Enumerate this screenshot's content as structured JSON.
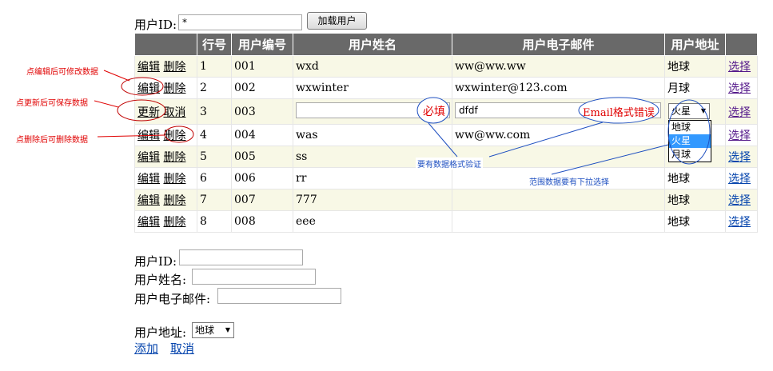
{
  "top": {
    "userid_label": "用户ID:",
    "userid_value": "*",
    "load_button": "加载用户"
  },
  "table": {
    "headers": [
      "",
      "行号",
      "用户编号",
      "用户姓名",
      "用户电子邮件",
      "用户地址",
      ""
    ],
    "rows": [
      {
        "a1": "编辑",
        "a2": "删除",
        "num": "1",
        "id": "001",
        "name": "wxd",
        "email": "ww@ww.ww",
        "addr": "地球",
        "select": "选择"
      },
      {
        "a1": "编辑",
        "a2": "删除",
        "num": "2",
        "id": "002",
        "name": "wxwinter",
        "email": "wxwinter@123.com",
        "addr": "月球",
        "select": "选择"
      },
      {
        "a1": "更新",
        "a2": "取消",
        "num": "3",
        "id": "003",
        "name": "",
        "email": "dfdf",
        "addr": "火星",
        "select": "选择"
      },
      {
        "a1": "编辑",
        "a2": "删除",
        "num": "4",
        "id": "004",
        "name": "was",
        "email": "ww@ww.com",
        "addr": "",
        "select": "选择"
      },
      {
        "a1": "编辑",
        "a2": "删除",
        "num": "5",
        "id": "005",
        "name": "ss",
        "email": "",
        "addr": "",
        "select": "选择"
      },
      {
        "a1": "编辑",
        "a2": "删除",
        "num": "6",
        "id": "006",
        "name": "rr",
        "email": "",
        "addr": "地球",
        "select": "选择"
      },
      {
        "a1": "编辑",
        "a2": "删除",
        "num": "7",
        "id": "007",
        "name": "777",
        "email": "",
        "addr": "地球",
        "select": "选择"
      },
      {
        "a1": "编辑",
        "a2": "删除",
        "num": "8",
        "id": "008",
        "name": "eee",
        "email": "",
        "addr": "地球",
        "select": "选择"
      }
    ],
    "dropdown_options": [
      "地球",
      "火星",
      "月球"
    ],
    "dropdown_selected": "火星"
  },
  "annotations": {
    "edit_note": "点编辑后可修改数据",
    "update_note": "点更新后可保存数据",
    "delete_note": "点删除后可删除数据",
    "required": "必填",
    "email_error": "Email格式错误",
    "format_validate": "要有数据格式验证",
    "range_dropdown": "范围数据要有下拉选择"
  },
  "form": {
    "userid_label": "用户ID:",
    "name_label": "用户姓名:",
    "email_label": "用户电子邮件:",
    "address_label": "用户地址:",
    "address_value": "地球",
    "add_link": "添加",
    "cancel_link": "取消"
  },
  "colors": {
    "header_bg": "#696969",
    "alt_row_bg": "#f8f8e6",
    "annotation_red": "#e00000",
    "annotation_blue": "#1e4fc0"
  }
}
